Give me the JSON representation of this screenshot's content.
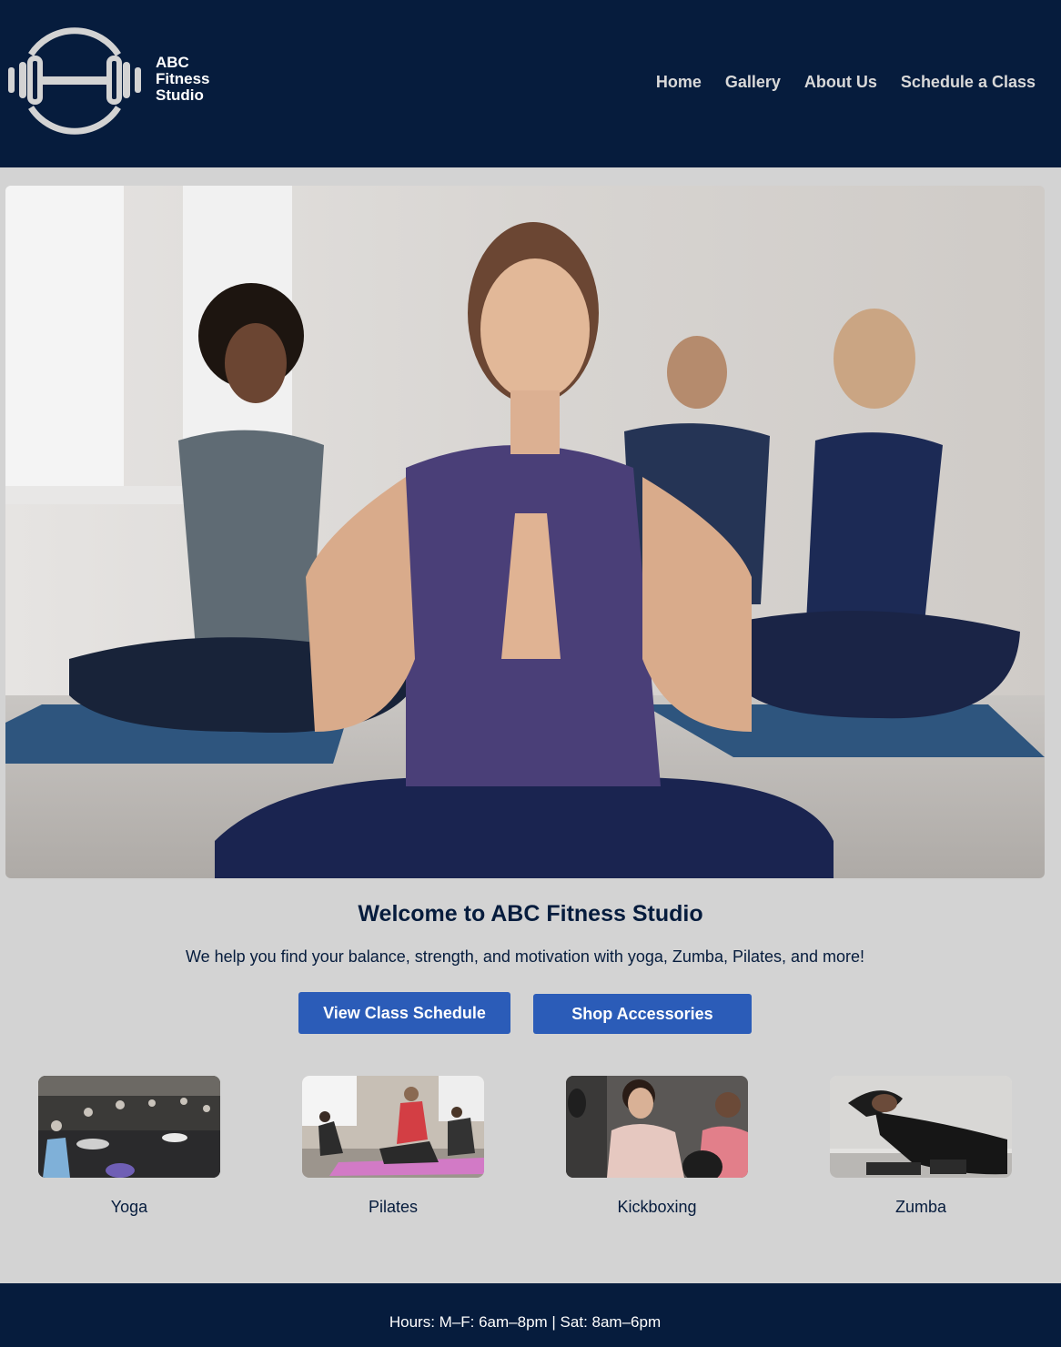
{
  "header": {
    "brand_lines": [
      "ABC",
      "Fitness",
      "Studio"
    ],
    "nav": [
      "Home",
      "Gallery",
      "About Us",
      "Schedule a Class"
    ]
  },
  "hero": {
    "image": "yoga-class-meditation-photo"
  },
  "welcome": {
    "title": "Welcome to ABC Fitness Studio",
    "subtitle": "We help you find your balance, strength, and motivation with yoga, Zumba, Pilates, and more!"
  },
  "buttons": {
    "schedule": "View Class Schedule",
    "shop": "Shop Accessories"
  },
  "classes": [
    {
      "label": "Yoga",
      "image": "yoga-group-photo"
    },
    {
      "label": "Pilates",
      "image": "pilates-group-photo"
    },
    {
      "label": "Kickboxing",
      "image": "kickboxing-photo"
    },
    {
      "label": "Zumba",
      "image": "zumba-photo"
    }
  ],
  "footer": {
    "hours": "Hours: M–F: 6am–8pm | Sat: 8am–6pm"
  },
  "colors": {
    "navy": "#061c3d",
    "page_bg": "#d3d3d3",
    "button_blue": "#2b5cb8"
  }
}
